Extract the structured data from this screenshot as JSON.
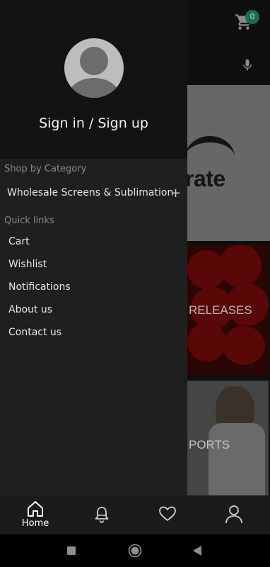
{
  "background": {
    "cart_badge_count": "0",
    "banner_text": "rate",
    "tile_new_releases_text": "RELEASES",
    "tile_sports_text": "PORTS"
  },
  "drawer": {
    "sign_in_label": "Sign in / Sign up",
    "shop_by_category_label": "Shop by Category",
    "categories": [
      {
        "label": "Wholesale Screens & Sublimation",
        "expand_icon": "plus-icon"
      }
    ],
    "quick_links_label": "Quick links",
    "quick_links": [
      {
        "label": "Cart"
      },
      {
        "label": "Wishlist"
      },
      {
        "label": "Notifications"
      },
      {
        "label": "About us"
      },
      {
        "label": "Contact us"
      }
    ]
  },
  "bottom_nav": {
    "items": [
      {
        "label": "Home",
        "icon": "home-icon",
        "active": true
      },
      {
        "label": "",
        "icon": "bell-icon"
      },
      {
        "label": "",
        "icon": "heart-icon"
      },
      {
        "label": "",
        "icon": "profile-icon"
      }
    ]
  },
  "system_nav": [
    "recents-icon",
    "home-circle-icon",
    "back-icon"
  ],
  "colors": {
    "drawer_bg": "#1f1f1f",
    "drawer_header_bg": "#131313",
    "badge": "#1c6b58",
    "bottom_nav_bg": "#1b1b1b"
  }
}
